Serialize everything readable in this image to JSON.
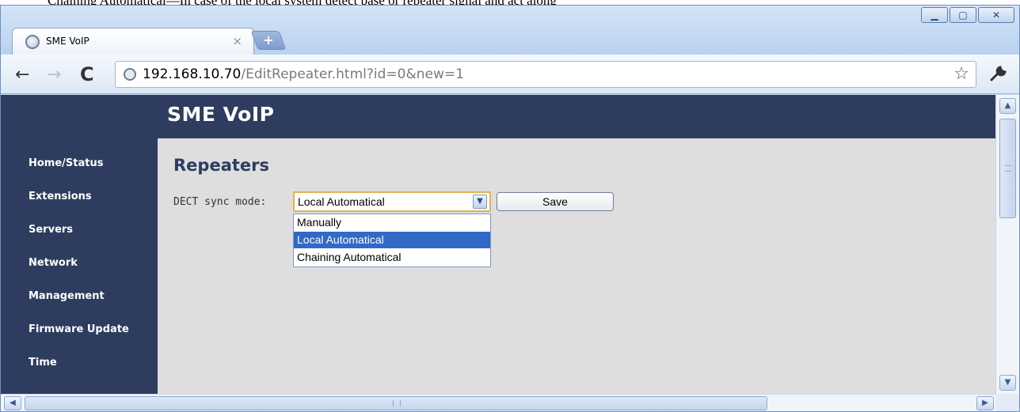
{
  "document": {
    "cropped_text": "Chaining Automatical—In case of the local system detect base or repeater signal and act along"
  },
  "window": {
    "minimize_glyph": "▁",
    "maximize_glyph": "▢",
    "close_glyph": "✕"
  },
  "tab": {
    "title": "SME VoIP",
    "close_glyph": "×",
    "new_tab_glyph": "+"
  },
  "toolbar": {
    "back_glyph": "←",
    "forward_glyph": "→",
    "reload_glyph": "C",
    "url_host": "192.168.10.70",
    "url_path": "/EditRepeater.html?id=0&new=1",
    "star_glyph": "☆",
    "wrench_glyph": "🔧"
  },
  "site": {
    "title": "SME VoIP"
  },
  "sidebar": {
    "items": [
      {
        "label": "Home/Status"
      },
      {
        "label": "Extensions"
      },
      {
        "label": "Servers"
      },
      {
        "label": "Network"
      },
      {
        "label": "Management"
      },
      {
        "label": "Firmware Update"
      },
      {
        "label": "Time"
      }
    ]
  },
  "main": {
    "heading": "Repeaters",
    "sync_mode_label": "DECT sync mode:",
    "sync_mode_value": "Local Automatical",
    "sync_mode_options": [
      "Manually",
      "Local Automatical",
      "Chaining Automatical"
    ],
    "sync_mode_selected_index": 1,
    "save_label": "Save"
  },
  "colors": {
    "nav_background": "#2e3d5f",
    "content_background": "#dedede",
    "selected_option": "#3169c6",
    "select_focus_border": "#e3b24e"
  },
  "icons": {
    "favicon": "globe-icon",
    "back": "back-arrow-icon",
    "forward": "forward-arrow-icon",
    "reload": "reload-icon",
    "bookmark": "star-icon",
    "settings": "wrench-icon",
    "dropdown": "chevron-down-icon"
  }
}
